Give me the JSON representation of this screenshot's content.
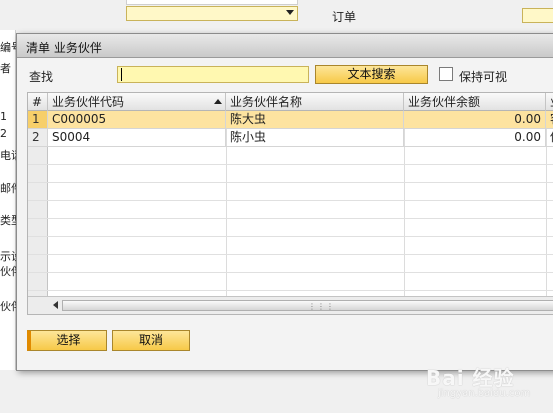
{
  "background_form": {
    "order_label": "订单",
    "left_labels": [
      "编号",
      "者",
      "1",
      "2",
      "电话",
      "邮件",
      "类型",
      "示设",
      "伙伴",
      "伙伴"
    ]
  },
  "dialog": {
    "title": "清单 业务伙伴",
    "find_label": "查找",
    "find_value": "",
    "search_button": "文本搜索",
    "keep_visible_label": "保持可视",
    "keep_visible_checked": false,
    "columns": [
      "#",
      "业务伙伴代码",
      "业务伙伴名称",
      "业务伙伴余额",
      "业"
    ],
    "rows": [
      {
        "num": "1",
        "code": "C000005",
        "name": "陈大虫",
        "balance": "0.00",
        "extra": "客",
        "selected": true
      },
      {
        "num": "2",
        "code": "S0004",
        "name": "陈小虫",
        "balance": "0.00",
        "extra": "供",
        "selected": false
      }
    ],
    "select_button": "选择",
    "cancel_button": "取消"
  },
  "watermark": {
    "brand": "Bai 经验",
    "url": "jingyan.baidu.com"
  },
  "colors": {
    "accent_yellow": "#f7c948",
    "selected_row": "#fde3a0",
    "input_yellow": "#fff8b0"
  }
}
